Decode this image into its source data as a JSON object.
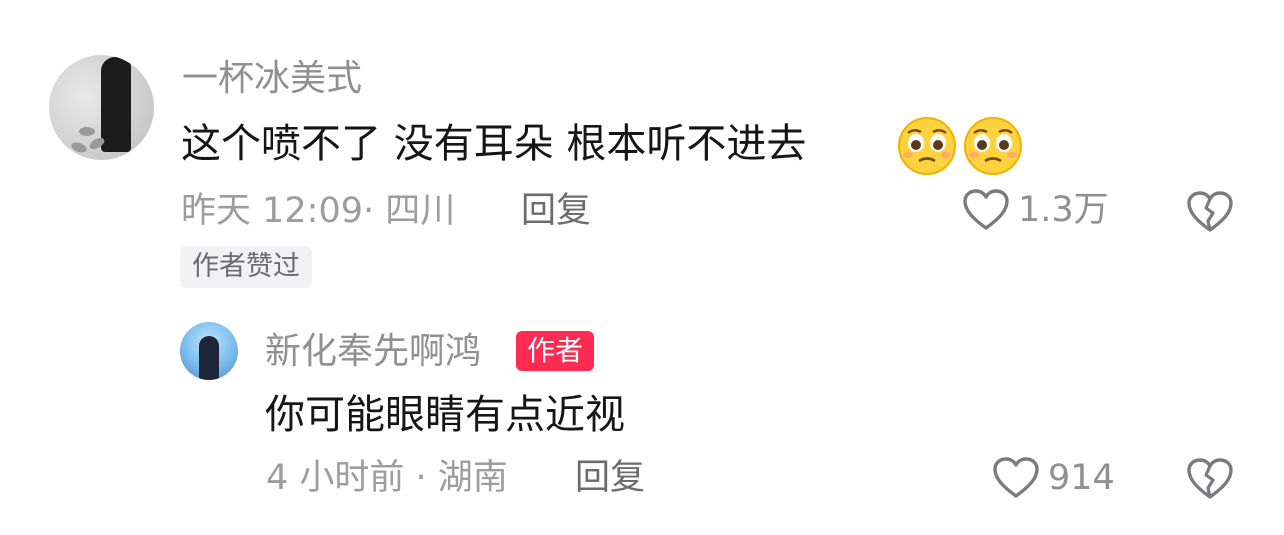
{
  "comment": {
    "username": "一杯冰美式",
    "text": "这个喷不了  没有耳朵 根本听不进去",
    "emoji": "pleading-face-emoji",
    "meta": "昨天 12:09· 四川",
    "reply_label": "回复",
    "like_count": "1.3万",
    "liked_badge": "作者赞过"
  },
  "reply": {
    "username": "新化奉先啊鸿",
    "author_badge": "作者",
    "text": "你可能眼睛有点近视",
    "meta": "4 小时前 · 湖南",
    "reply_label": "回复",
    "like_count": "914"
  },
  "colors": {
    "author_badge": "#fe2c55",
    "username": "#8f8f94",
    "text": "#161616",
    "meta": "#9c9ca1"
  },
  "icons": [
    "heart-outline-icon",
    "broken-heart-icon"
  ]
}
